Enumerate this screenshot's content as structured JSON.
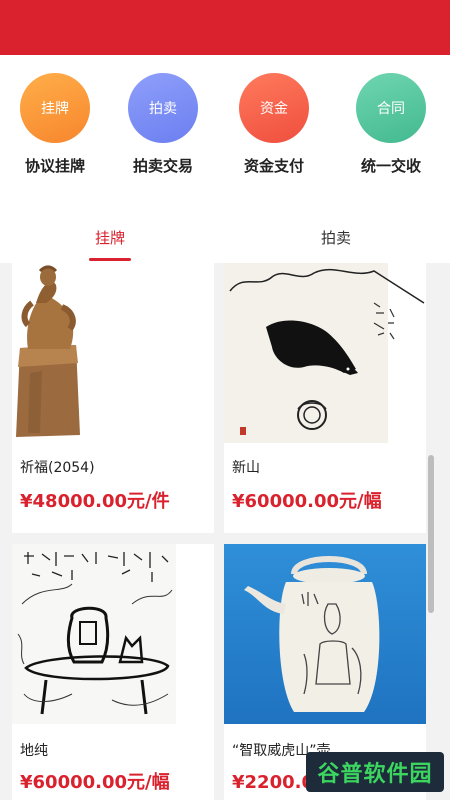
{
  "features": [
    {
      "circle": "挂牌",
      "label": "协议挂牌",
      "color": "#f7862d"
    },
    {
      "circle": "拍卖",
      "label": "拍卖交易",
      "color": "#6b7ff0"
    },
    {
      "circle": "资金",
      "label": "资金支付",
      "color": "#ef4e3e"
    },
    {
      "circle": "合同",
      "label": "统一交收",
      "color": "#43b990"
    }
  ],
  "tabs": [
    {
      "label": "挂牌",
      "active": true
    },
    {
      "label": "拍卖",
      "active": false
    }
  ],
  "products": [
    {
      "title": "祈福(2054)",
      "price": "¥48000.00元/件",
      "image": "wooden-sculpture"
    },
    {
      "title": "新山",
      "price": "¥60000.00元/幅",
      "image": "ink-bird-painting"
    },
    {
      "title": "地纯",
      "price": "¥60000.00元/幅",
      "image": "ink-sketch-painting"
    },
    {
      "title": "“智取威虎山”壶",
      "price": "¥2200.00元/件",
      "image": "teapot"
    }
  ],
  "watermark": "谷普软件园",
  "theme": {
    "accent": "#d9222e"
  }
}
